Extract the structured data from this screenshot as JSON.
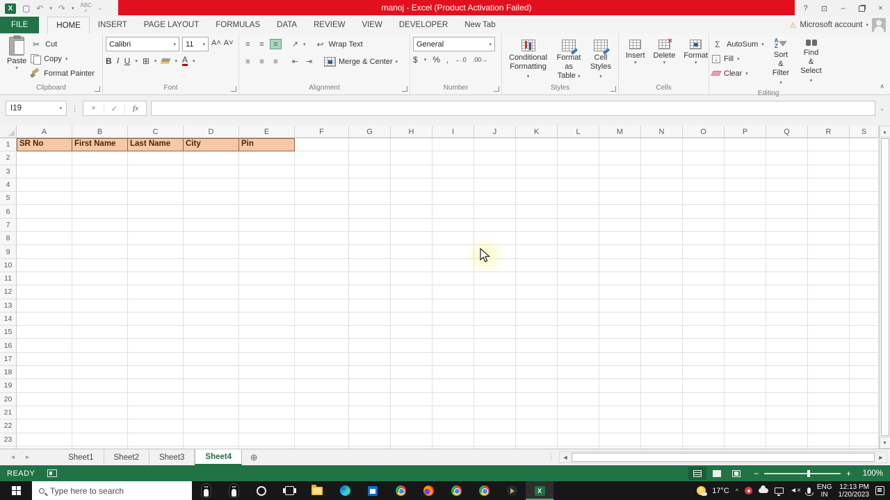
{
  "titlebar": {
    "title": "manoj -  Excel (Product Activation Failed)",
    "qat_icons": [
      "excel-logo",
      "save",
      "undo",
      "redo",
      "spelling",
      "customize-quick-access"
    ],
    "window_icons": [
      "help",
      "ribbon-display-options",
      "minimize",
      "restore",
      "close"
    ]
  },
  "glyphs": {
    "help": "?",
    "minimize": "–",
    "close": "×",
    "undo": "↶",
    "redo": "↷",
    "spelling_abc": "ABC",
    "spelling_check": "✓",
    "dropdown": "▾",
    "up": "▴",
    "down": "▾",
    "nav_left": "◂",
    "nav_right": "▸",
    "scroll_left": "◀",
    "scroll_right": "▶",
    "add_sheet": "⊕",
    "collapse_ribbon": "∧",
    "warning": "⚠",
    "dots": "⋮",
    "cancel": "×",
    "check": "✓",
    "fx": "fx",
    "cut": "✂",
    "sigma": "Σ",
    "bold": "B",
    "italic": "I",
    "underline": "U",
    "borders": "⊞",
    "align": "≡",
    "orientation": "↗",
    "wrap": "↩",
    "indent_dec": "⇤",
    "indent_inc": "⇥",
    "currency": "$",
    "percent": "%",
    "comma": ",",
    "dec_inc": "←.0",
    "dec_dec": ".00→",
    "fill_arrow": "↓",
    "font_grow": "A▴",
    "font_shrink": "A▾",
    "font_color": "A",
    "chevron_up_tray": "^",
    "muted_speaker": "◄×",
    "formula_expand": "⌄"
  },
  "ribbon": {
    "active": "HOME",
    "tabs": [
      "FILE",
      "HOME",
      "INSERT",
      "PAGE LAYOUT",
      "FORMULAS",
      "DATA",
      "REVIEW",
      "VIEW",
      "DEVELOPER",
      "New Tab"
    ],
    "groups": {
      "clipboard": {
        "label": "Clipboard",
        "paste": "Paste",
        "cut": "Cut",
        "copy": "Copy",
        "painter": "Format Painter"
      },
      "font": {
        "label": "Font",
        "family": "Calibri",
        "size": "11"
      },
      "alignment": {
        "label": "Alignment",
        "wrap": "Wrap Text",
        "merge": "Merge & Center"
      },
      "number": {
        "label": "Number",
        "format": "General"
      },
      "styles": {
        "label": "Styles",
        "cond1": "Conditional",
        "cond2": "Formatting",
        "fmt1": "Format as",
        "fmt2": "Table",
        "cs1": "Cell",
        "cs2": "Styles"
      },
      "cells": {
        "label": "Cells",
        "insert": "Insert",
        "delete": "Delete",
        "format": "Format"
      },
      "editing": {
        "label": "Editing",
        "autosum": "AutoSum",
        "fill": "Fill",
        "clear": "Clear",
        "sort1": "Sort &",
        "sort2": "Filter",
        "find1": "Find &",
        "find2": "Select"
      }
    }
  },
  "account_label": "Microsoft account",
  "formula_bar": {
    "name_box": "I19",
    "value": ""
  },
  "grid": {
    "columns": [
      "A",
      "B",
      "C",
      "D",
      "E",
      "F",
      "G",
      "H",
      "I",
      "J",
      "K",
      "L",
      "M",
      "N",
      "O",
      "P",
      "Q",
      "R",
      "S"
    ],
    "rows": 24,
    "header_cells": {
      "A": "SR No",
      "B": "First Name",
      "C": "Last Name",
      "D": "City",
      "E": "Pin"
    }
  },
  "sheetbar": {
    "sheets": [
      "Sheet1",
      "Sheet2",
      "Sheet3",
      "Sheet4"
    ],
    "active": "Sheet4"
  },
  "status": {
    "mode": "READY",
    "zoom": "100%"
  },
  "taskbar": {
    "search_placeholder": "Type here to search",
    "apps": [
      "penguin-app-1",
      "penguin-app-2",
      "cortana",
      "task-view",
      "file-explorer",
      "edge",
      "store",
      "chrome",
      "firefox",
      "chrome-profile-1",
      "chrome-profile-2",
      "media-player",
      "excel"
    ],
    "active_app": "excel",
    "tray": {
      "temperature": "17°C",
      "lang_top": "ENG",
      "lang_bottom": "IN",
      "time": "12:13 PM",
      "date": "1/20/2023"
    }
  }
}
